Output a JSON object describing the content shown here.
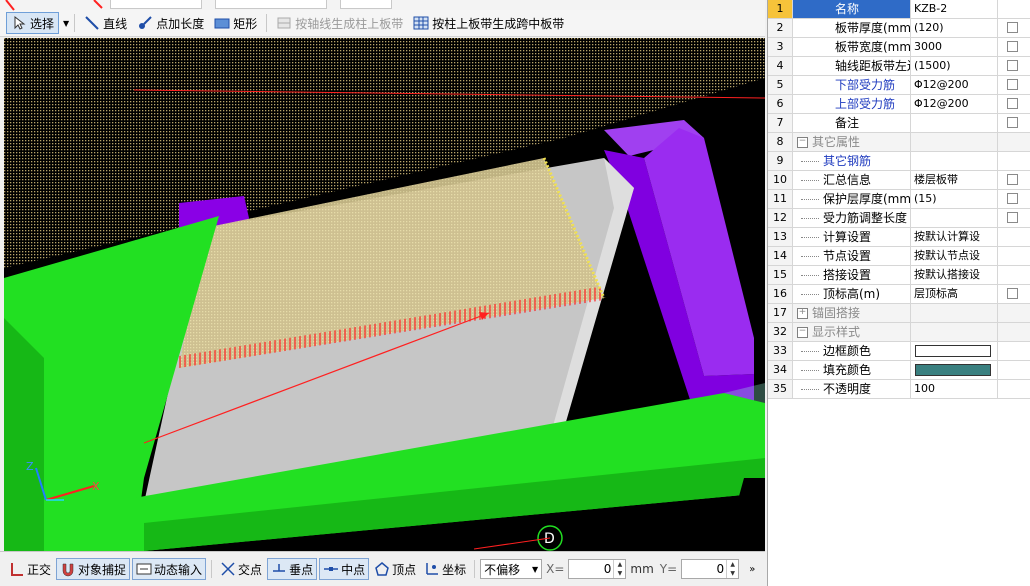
{
  "toolbar": {
    "select_label": "选择",
    "line_label": "直线",
    "point_length_label": "点加长度",
    "rect_label": "矩形",
    "axis_gen_label": "按轴线生成柱上板带",
    "col_gen_label": "按柱上板带生成跨中板带"
  },
  "canvas": {
    "axis_label": "D",
    "z_label": "Z",
    "x_label": "X",
    "colors": {
      "background": "#000000",
      "green": "#22dd22",
      "purple": "#8a00e6",
      "slab_fill": "#c8c8c8",
      "yellow_band": "#e6d68a",
      "arrow": "#ff2020"
    }
  },
  "props": {
    "rows": [
      {
        "num": "1",
        "name": "名称",
        "value": "KZB-2",
        "check": false,
        "selected": true
      },
      {
        "num": "2",
        "name": "板带厚度(mm)",
        "value": "(120)",
        "check": true
      },
      {
        "num": "3",
        "name": "板带宽度(mm)",
        "value": "3000",
        "check": true
      },
      {
        "num": "4",
        "name": "轴线距板带左边线",
        "value": "(1500)",
        "check": true
      },
      {
        "num": "5",
        "name": "下部受力筋",
        "value": "Φ12@200",
        "check": true,
        "blue": true
      },
      {
        "num": "6",
        "name": "上部受力筋",
        "value": "Φ12@200",
        "check": true,
        "blue": true
      },
      {
        "num": "7",
        "name": "备注",
        "value": "",
        "check": true
      },
      {
        "num": "8",
        "name": "其它属性",
        "value": "",
        "group": true,
        "expander": "−"
      },
      {
        "num": "9",
        "name": "其它钢筋",
        "value": "",
        "tree": true,
        "blue": true
      },
      {
        "num": "10",
        "name": "汇总信息",
        "value": "楼层板带",
        "check": true,
        "tree": true
      },
      {
        "num": "11",
        "name": "保护层厚度(mm)",
        "value": "(15)",
        "check": true,
        "tree": true
      },
      {
        "num": "12",
        "name": "受力筋调整长度",
        "value": "",
        "check": true,
        "tree": true
      },
      {
        "num": "13",
        "name": "计算设置",
        "value": "按默认计算设",
        "tree": true
      },
      {
        "num": "14",
        "name": "节点设置",
        "value": "按默认节点设",
        "tree": true
      },
      {
        "num": "15",
        "name": "搭接设置",
        "value": "按默认搭接设",
        "tree": true
      },
      {
        "num": "16",
        "name": "顶标高(m)",
        "value": "层顶标高",
        "check": true,
        "tree": true
      },
      {
        "num": "17",
        "name": "锚固搭接",
        "value": "",
        "group": true,
        "expander": "+"
      },
      {
        "num": "32",
        "name": "显示样式",
        "value": "",
        "group": true,
        "expander": "−"
      },
      {
        "num": "33",
        "name": "边框颜色",
        "value": "",
        "tree": true,
        "color": "#ffffff"
      },
      {
        "num": "34",
        "name": "填充颜色",
        "value": "",
        "tree": true,
        "color": "#3a8080"
      },
      {
        "num": "35",
        "name": "不透明度",
        "value": "100",
        "tree": true
      }
    ]
  },
  "statusbar": {
    "ortho_label": "正交",
    "snap_label": "对象捕捉",
    "dyn_input_label": "动态输入",
    "intersect_label": "交点",
    "perp_label": "垂点",
    "mid_label": "中点",
    "vertex_label": "顶点",
    "coord_label": "坐标",
    "offset_value": "不偏移",
    "x_label": "X=",
    "x_value": "0",
    "mm_label": "mm",
    "y_label": "Y=",
    "y_value": "0"
  }
}
